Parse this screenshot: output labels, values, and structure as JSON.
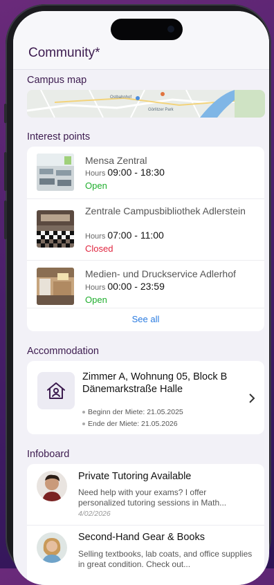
{
  "header": {
    "title": "Community*"
  },
  "campus_map": {
    "title": "Campus map",
    "map_labels": [
      "Ostbahnhof",
      "Görlitzer Park"
    ]
  },
  "interest_points": {
    "title": "Interest points",
    "hours_label": "Hours",
    "see_all": "See all",
    "items": [
      {
        "name": "Mensa Zentral",
        "hours": "09:00 - 18:30",
        "status": "Open",
        "status_color": "#1fae2d",
        "image": "cafeteria-photo"
      },
      {
        "name": "Zentrale Campusbibliothek Adlerstein",
        "hours": "07:00 - 11:00",
        "status": "Closed",
        "status_color": "#e0243e",
        "image": "library-photo"
      },
      {
        "name": "Medien- und Druckservice Adlerhof",
        "hours": "00:00 - 23:59",
        "status": "Open",
        "status_color": "#1fae2d",
        "image": "print-service-photo"
      }
    ]
  },
  "accommodation": {
    "title": "Accommodation",
    "name": "Zimmer A, Wohnung 05, Block B Dänemarkstraße Halle",
    "start_label": "Beginn der Miete: 21.05.2025",
    "end_label": "Ende der Miete: 21.05.2026",
    "icon": "home-user-icon"
  },
  "infoboard": {
    "title": "Infoboard",
    "items": [
      {
        "title": "Private Tutoring Available",
        "description": "Need help with your exams? I offer personalized tutoring sessions in Math...",
        "date": "4/02/2026",
        "avatar": "male-avatar"
      },
      {
        "title": "Second-Hand Gear & Books",
        "description": "Selling textbooks, lab coats, and office supplies in great condition. Check out...",
        "date": "",
        "avatar": "female-avatar"
      }
    ]
  },
  "colors": {
    "brand": "#3c1b4f",
    "link": "#2a7be0",
    "open": "#1fae2d",
    "closed": "#e0243e",
    "screen_bg": "#f2f1f7"
  }
}
